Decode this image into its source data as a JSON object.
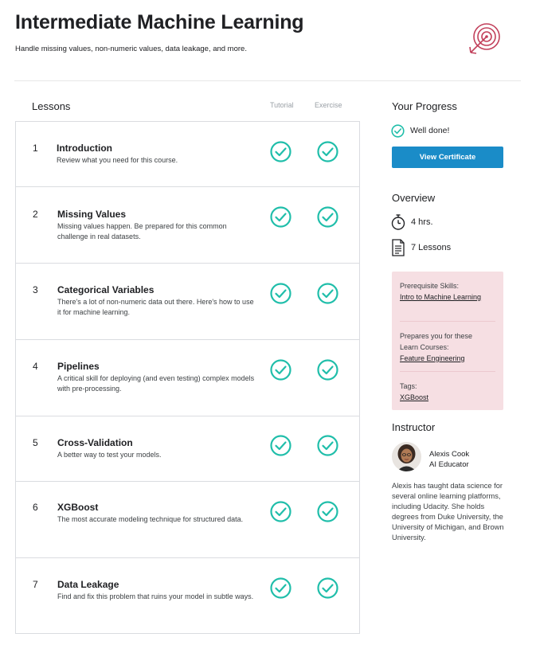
{
  "header": {
    "title": "Intermediate Machine Learning",
    "subtitle": "Handle missing values, non-numeric values, data leakage, and more.",
    "logo_icon": "target-arrow-icon"
  },
  "lessons": {
    "heading": "Lessons",
    "col_tutorial": "Tutorial",
    "col_exercise": "Exercise",
    "items": [
      {
        "num": "1",
        "title": "Introduction",
        "desc": "Review what you need for this course.",
        "tutorial_done": true,
        "exercise_done": true
      },
      {
        "num": "2",
        "title": "Missing Values",
        "desc": "Missing values happen. Be prepared for this common challenge in real datasets.",
        "tutorial_done": true,
        "exercise_done": true
      },
      {
        "num": "3",
        "title": "Categorical Variables",
        "desc": "There's a lot of non-numeric data out there. Here's how to use it for machine learning.",
        "tutorial_done": true,
        "exercise_done": true
      },
      {
        "num": "4",
        "title": "Pipelines",
        "desc": "A critical skill for deploying (and even testing) complex models with pre-processing.",
        "tutorial_done": true,
        "exercise_done": true
      },
      {
        "num": "5",
        "title": "Cross-Validation",
        "desc": "A better way to test your models.",
        "tutorial_done": true,
        "exercise_done": true
      },
      {
        "num": "6",
        "title": "XGBoost",
        "desc": "The most accurate modeling technique for structured data.",
        "tutorial_done": true,
        "exercise_done": true
      },
      {
        "num": "7",
        "title": "Data Leakage",
        "desc": "Find and fix this problem that ruins your model in subtle ways.",
        "tutorial_done": true,
        "exercise_done": true
      }
    ]
  },
  "progress": {
    "heading": "Your Progress",
    "status": "Well done!",
    "button": "View Certificate"
  },
  "overview": {
    "heading": "Overview",
    "duration": "4 hrs.",
    "lesson_count": "7 Lessons"
  },
  "skills": {
    "prereq_label": "Prerequisite Skills:",
    "prereq_link": "Intro to Machine Learning",
    "prepares_label": "Prepares you for these Learn Courses:",
    "prepares_link": "Feature Engineering",
    "tags_label": "Tags:",
    "tag": "XGBoost"
  },
  "instructor": {
    "heading": "Instructor",
    "name": "Alexis Cook",
    "role": "AI Educator",
    "bio": "Alexis has taught data science for several online learning platforms, including Udacity. She holds degrees from Duke University, the University of Michigan, and Brown University."
  },
  "colors": {
    "check_green": "#20beaa",
    "button_blue": "#1a8cc8",
    "panel_pink": "#f6dfe3",
    "logo_red": "#c2405b"
  }
}
